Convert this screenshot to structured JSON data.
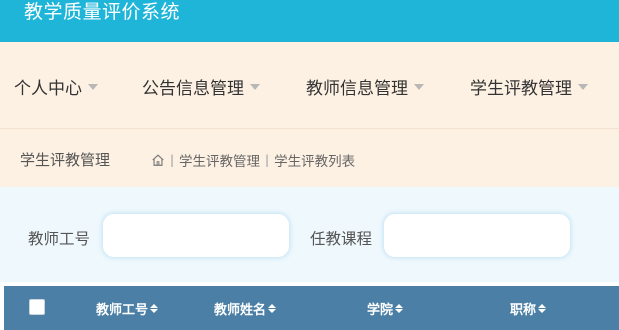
{
  "app": {
    "title": "教学质量评价系统"
  },
  "nav": {
    "items": [
      {
        "label": "个人中心"
      },
      {
        "label": "公告信息管理"
      },
      {
        "label": "教师信息管理"
      },
      {
        "label": "学生评教管理"
      }
    ]
  },
  "page": {
    "title": "学生评教管理",
    "breadcrumb": [
      "学生评教管理",
      "学生评教列表"
    ]
  },
  "filters": {
    "teacher_id": {
      "label": "教师工号",
      "value": "",
      "placeholder": ""
    },
    "course": {
      "label": "任教课程",
      "value": "",
      "placeholder": ""
    }
  },
  "table": {
    "columns": [
      "教师工号",
      "教师姓名",
      "学院",
      "职称"
    ]
  },
  "colors": {
    "topbar": "#1eb5d8",
    "nav_bg": "#fdf1e3",
    "filter_bg": "#eef8fd",
    "table_header": "#4b7fa6"
  },
  "icons": {
    "home": "home-icon",
    "sort": "sort-icon",
    "caret": "chevron-down-icon"
  }
}
